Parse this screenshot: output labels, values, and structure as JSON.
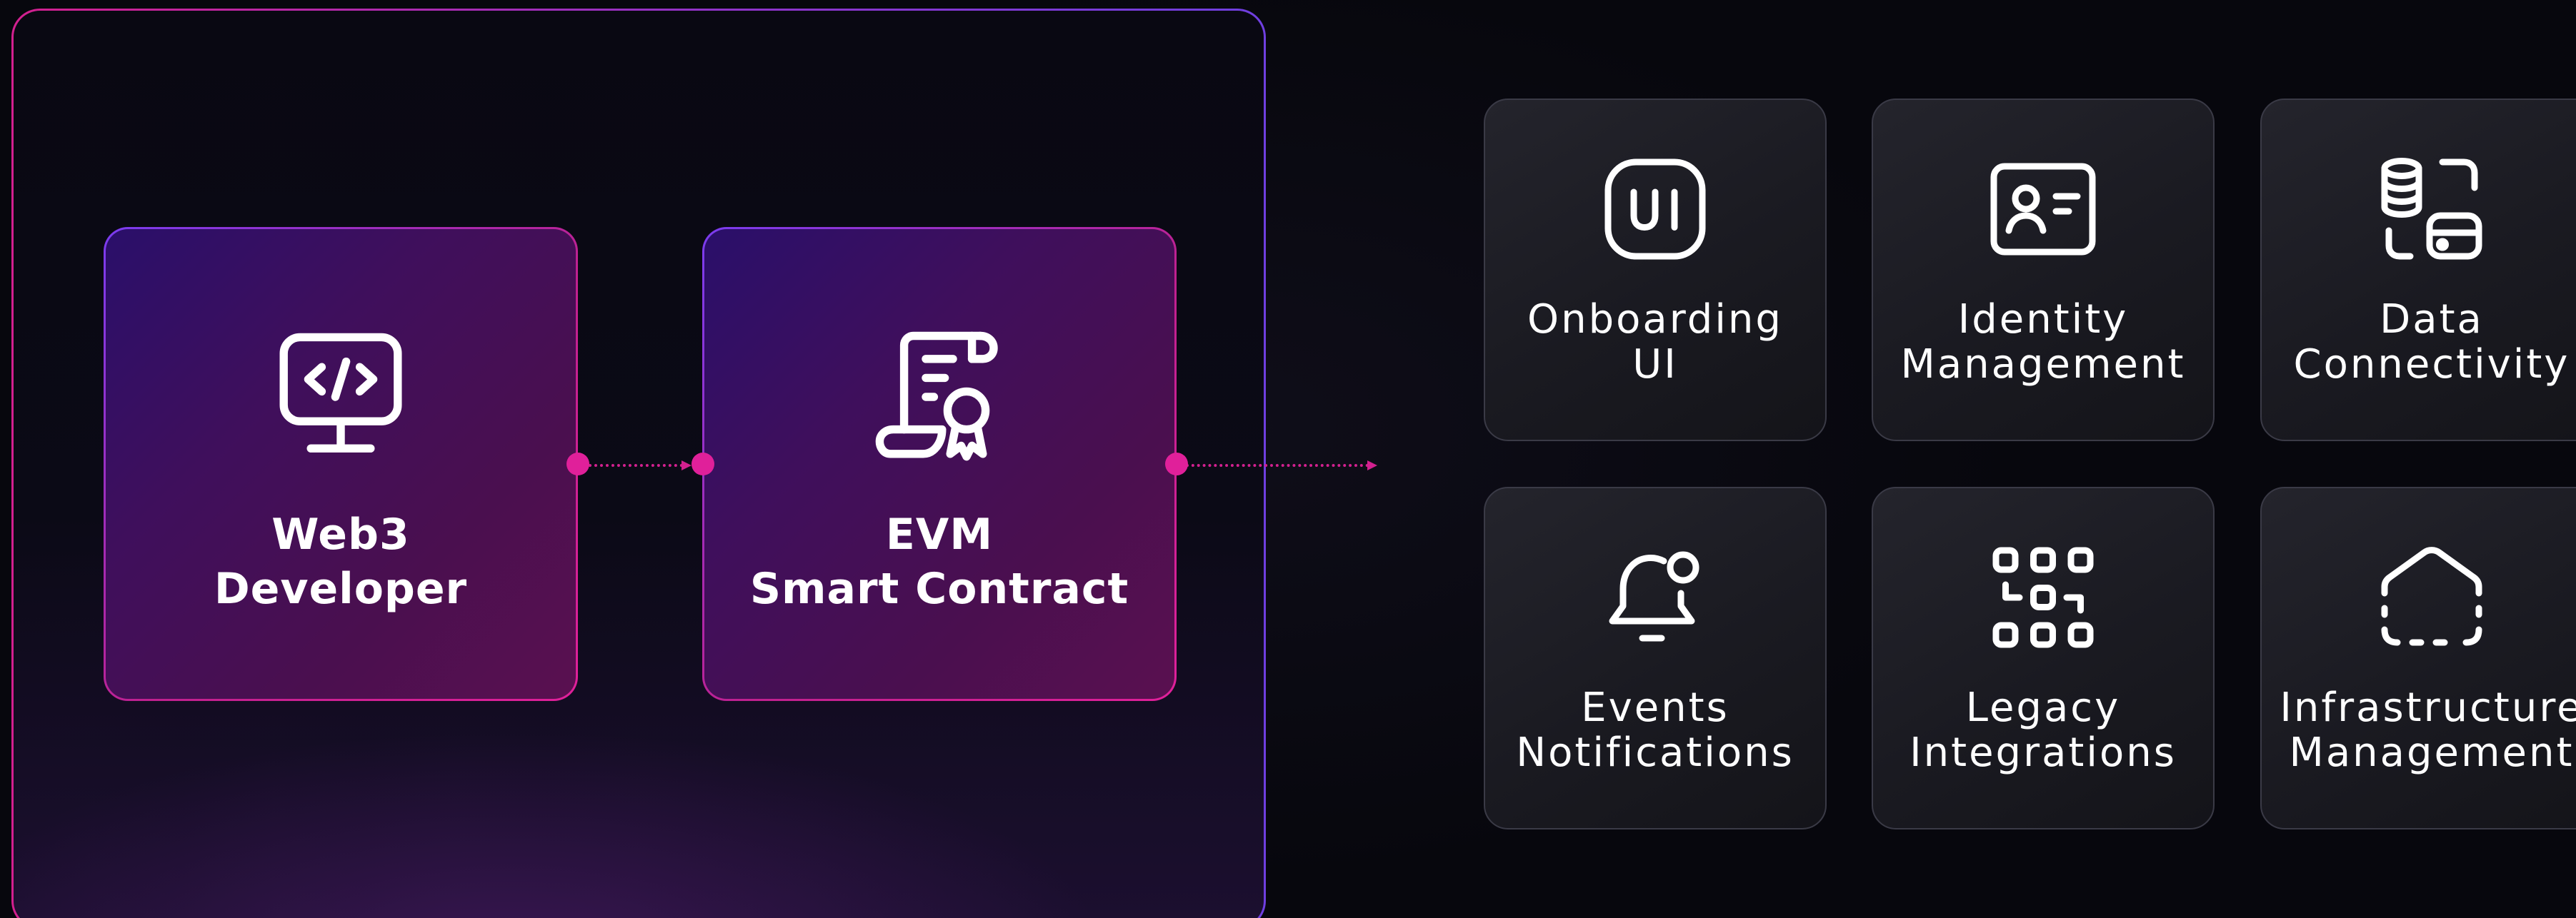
{
  "nodes": [
    {
      "id": "web3",
      "line1": "Web3",
      "line2": "Developer",
      "icon": "monitor-code-icon"
    },
    {
      "id": "evm",
      "line1": "EVM",
      "line2": "Smart Contract",
      "icon": "certificate-scroll-icon"
    }
  ],
  "services": [
    {
      "line1": "Onboarding",
      "line2": "UI",
      "icon": "ui-badge-icon"
    },
    {
      "line1": "Identity",
      "line2": "Management",
      "icon": "id-card-icon"
    },
    {
      "line1": "Data",
      "line2": "Connectivity",
      "icon": "database-link-icon"
    },
    {
      "line1": "Events",
      "line2": "Notifications",
      "icon": "bell-icon"
    },
    {
      "line1": "Legacy",
      "line2": "Integrations",
      "icon": "grid-blocks-icon"
    },
    {
      "line1": "Infrastructure",
      "line2": "Management",
      "icon": "house-outline-icon"
    }
  ],
  "colors": {
    "background": "#07070d",
    "accent_pink": "#e0209a",
    "accent_purple": "#6f3fe0",
    "card_border": "#3a3a46",
    "text": "#ffffff"
  }
}
